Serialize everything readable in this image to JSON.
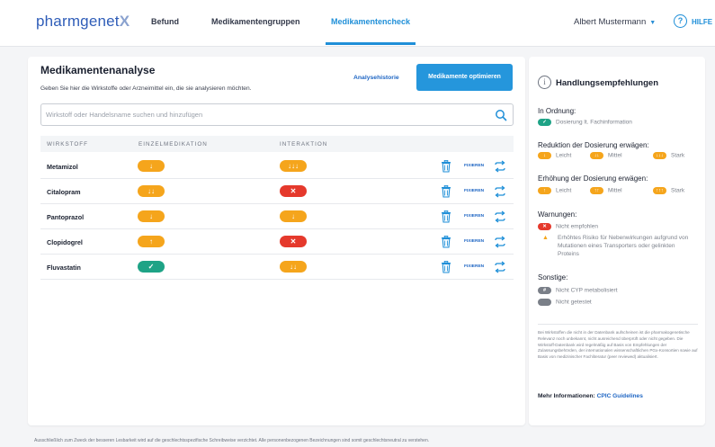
{
  "header": {
    "logo": {
      "main": "pharmgenet",
      "mark": "X"
    },
    "nav": [
      {
        "label": "Befund"
      },
      {
        "label": "Medikamentengruppen"
      },
      {
        "label": "Medikamentencheck",
        "active": true
      }
    ],
    "user": {
      "name": "Albert Mustermann",
      "caret": "▼"
    },
    "help": {
      "icon": "?",
      "label": "HILFE"
    },
    "accent_color": "#1f8fd8"
  },
  "main": {
    "title": "Medikamentenanalyse",
    "subtitle": "Geben Sie hier die Wirkstoffe oder Arzneimittel ein, die sie analysieren möchten.",
    "history_link": "Analysehistorie",
    "optimize_button": "Medikamente optimieren",
    "search": {
      "placeholder": "Wirkstoff oder Handelsname suchen und hinzufügen",
      "icon": "search-icon"
    },
    "columns": [
      "WIRKSTOFF",
      "EINZELMEDIKATION",
      "INTERAKTION"
    ],
    "rows": [
      {
        "name": "Metamizol",
        "single": {
          "color": "orange",
          "symbol": "↓"
        },
        "interaction": {
          "color": "orange",
          "symbol": "↓↓↓"
        },
        "fix_label": "FIXIEREN"
      },
      {
        "name": "Citalopram",
        "single": {
          "color": "orange",
          "symbol": "↓↓"
        },
        "interaction": {
          "color": "red",
          "symbol": "✕"
        },
        "fix_label": "FIXIEREN"
      },
      {
        "name": "Pantoprazol",
        "single": {
          "color": "orange",
          "symbol": "↓"
        },
        "interaction": {
          "color": "orange",
          "symbol": "↓"
        },
        "fix_label": "FIXIEREN"
      },
      {
        "name": "Clopidogrel",
        "single": {
          "color": "orange",
          "symbol": "↑"
        },
        "interaction": {
          "color": "red",
          "symbol": "✕"
        },
        "fix_label": "FIXIEREN"
      },
      {
        "name": "Fluvastatin",
        "single": {
          "color": "green",
          "symbol": "✓"
        },
        "interaction": {
          "color": "orange",
          "symbol": "↓↓"
        },
        "fix_label": "FIXIEREN"
      }
    ]
  },
  "side": {
    "title": "Handlungsempfehlungen",
    "ok": {
      "heading": "In Ordnung:",
      "items": [
        {
          "color": "green",
          "symbol": "✓",
          "label": "Dosierung lt. Fachinformation"
        }
      ]
    },
    "reduce": {
      "heading": "Reduktion der Dosierung erwägen:",
      "items": [
        {
          "color": "orange",
          "symbol": "↓",
          "label": "Leicht"
        },
        {
          "color": "orange",
          "symbol": "↓↓",
          "label": "Mittel"
        },
        {
          "color": "orange",
          "symbol": "↓↓↓",
          "label": "Stark"
        }
      ]
    },
    "increase": {
      "heading": "Erhöhung der Dosierung erwägen:",
      "items": [
        {
          "color": "orange",
          "symbol": "↑",
          "label": "Leicht"
        },
        {
          "color": "orange",
          "symbol": "↑↑",
          "label": "Mittel"
        },
        {
          "color": "orange",
          "symbol": "↑↑↑",
          "label": "Stark"
        }
      ]
    },
    "warnings": {
      "heading": "Warnungen:",
      "not_recommended": {
        "color": "red",
        "symbol": "✕",
        "label": "Nicht empfohlen"
      },
      "risk": "Erhöhtes Risiko für Nebenwirkungen aufgrund von Mutationen eines Transporters oder gelinkten Proteins"
    },
    "other": {
      "heading": "Sonstige:",
      "items": [
        {
          "color": "grey",
          "symbol": "#",
          "label": "Nicht CYP metabolisiert"
        },
        {
          "color": "grey",
          "symbol": "",
          "label": "Nicht getestet"
        }
      ]
    },
    "disclaimer": "Bei Wirkstoffen die nicht in der Datenbank aufscheinen ist die pharmakogenetische Relevanz noch unbekannt, nicht ausreichend überprüft oder nicht gegeben. Die Wirkstoff-Datenbank wird regelmäßig auf Basis von Empfehlungen der Zulassungsbehörden, der internationalen wissenschaftlichen PGx-Konsortien sowie auf Basis von medizinischer Fachliteratur (peer reviewed) aktualisiert.",
    "more_info": {
      "label": "Mehr Informationen:",
      "link": "CPIC Guidelines"
    }
  },
  "footer": "Ausschließlich zum Zweck der besseren Lesbarkeit wird auf die geschlechtsspezifische Schreibweise verzichtet. Alle personenbezogenen Bezeichnungen sind somit geschlechtsneutral zu verstehen."
}
